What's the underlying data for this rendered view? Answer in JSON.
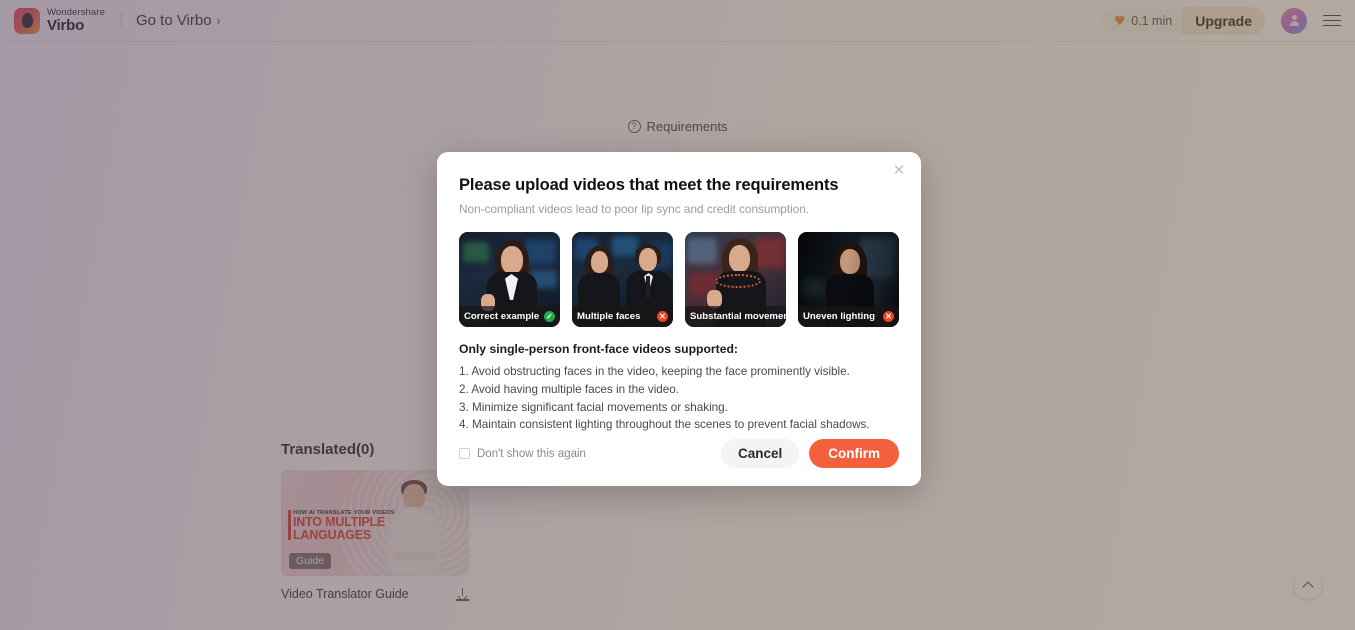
{
  "header": {
    "brand_name_top": "Wondershare",
    "brand_name_main": "Virbo",
    "goto_label": "Go to Virbo",
    "goto_chevron": "›",
    "credits": "0.1 min",
    "upgrade_label": "Upgrade"
  },
  "page": {
    "requirements_link": "Requirements",
    "requirements_icon_glyph": "?",
    "translated_heading": "Translated(0)",
    "video_card": {
      "overline": "HOW AI TRANSLATE YOUR VIDEOS",
      "headline_line1": "INTO MULTIPLE",
      "headline_line2": "LANGUAGES",
      "badge": "Guide",
      "caption": "Video Translator Guide"
    }
  },
  "modal": {
    "close_glyph": "✕",
    "title": "Please upload videos that meet the requirements",
    "subtitle": "Non-compliant videos lead to poor lip sync and credit consumption.",
    "cards": [
      {
        "label": "Correct example",
        "status": "ok",
        "badge_glyph": "✓"
      },
      {
        "label": "Multiple faces",
        "status": "no",
        "badge_glyph": "✕"
      },
      {
        "label": "Substantial movement",
        "status": "no",
        "badge_glyph": "✕"
      },
      {
        "label": "Uneven lighting",
        "status": "no",
        "badge_glyph": "✕"
      }
    ],
    "requirements_heading": "Only single-person front-face videos supported:",
    "requirements": [
      "1. Avoid obstructing faces in the video, keeping the face prominently visible.",
      "2. Avoid having multiple faces in the video.",
      "3. Minimize significant facial movements or shaking.",
      "4. Maintain consistent lighting throughout the scenes to prevent facial shadows."
    ],
    "dont_show_label": "Don't show this again",
    "cancel_label": "Cancel",
    "confirm_label": "Confirm"
  },
  "colors": {
    "accent_confirm": "#f2603c",
    "status_ok": "#21a84a",
    "status_no": "#ef4422",
    "upgrade_bg": "#f7ead6"
  }
}
